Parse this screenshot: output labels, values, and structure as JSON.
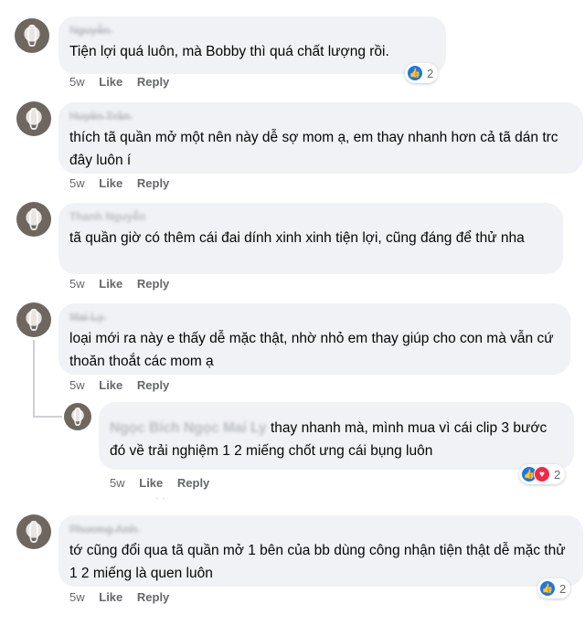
{
  "comments": [
    {
      "name": "N̶g̶u̶y̶ễ̶n̶",
      "text": "Tiện lợi quá luôn, mà Bobby thì quá chất lượng rồi.",
      "time": "5w",
      "like": "Like",
      "reply": "Reply",
      "reaction_count": "2",
      "reactions": [
        "like-icon"
      ]
    },
    {
      "name": "H̶u̶y̶ề̶n̶ ̶T̶r̶ầ̶n̶",
      "text": "thích tã quần mở một nên này dễ sợ mom ạ, em thay nhanh hơn cả tã dán trc đây luôn í",
      "time": "5w",
      "like": "Like",
      "reply": "Reply"
    },
    {
      "name": "Thanh Nguyễn",
      "text": "tã quần giờ có thêm cái đai dính xinh xinh tiện lợi, cũng đáng để thử nha",
      "time": "5w",
      "like": "Like",
      "reply": "Reply"
    },
    {
      "name": "M̶a̶i̶ ̶L̶y̶",
      "text": "loại mới ra này e thấy dễ mặc thật, nhờ nhỏ em thay giúp cho con mà vẫn cứ thoăn thoắt các mom ạ",
      "time": "5w",
      "like": "Like",
      "reply": "Reply"
    },
    {
      "name": "P̶h̶ư̶ơ̶n̶g̶ ̶A̶n̶h̶",
      "text": "tớ cũng đổi qua tã quần mở 1 bên của bb dùng công nhận tiện thật dễ mặc thử 1 2 miếng là quen luôn",
      "time": "5w",
      "like": "Like",
      "reply": "Reply",
      "reaction_count": "2",
      "reactions": [
        "like-icon"
      ]
    }
  ],
  "reply": {
    "name": "Ngọc Bích Ngọc",
    "tag": "Mai Ly",
    "text": " thay nhanh mà, mình mua vì cái clip 3 bước đó về trải nghiệm 1 2 miếng chốt ưng cái bụng luôn",
    "time": "5w",
    "like": "Like",
    "reply": "Reply",
    "reaction_count": "2",
    "reactions": [
      "like-icon",
      "heart-icon"
    ]
  },
  "colors": {
    "like": "#1877f2",
    "love": "#f02849",
    "bubble": "#f0f2f5",
    "meta": "#65676b"
  }
}
